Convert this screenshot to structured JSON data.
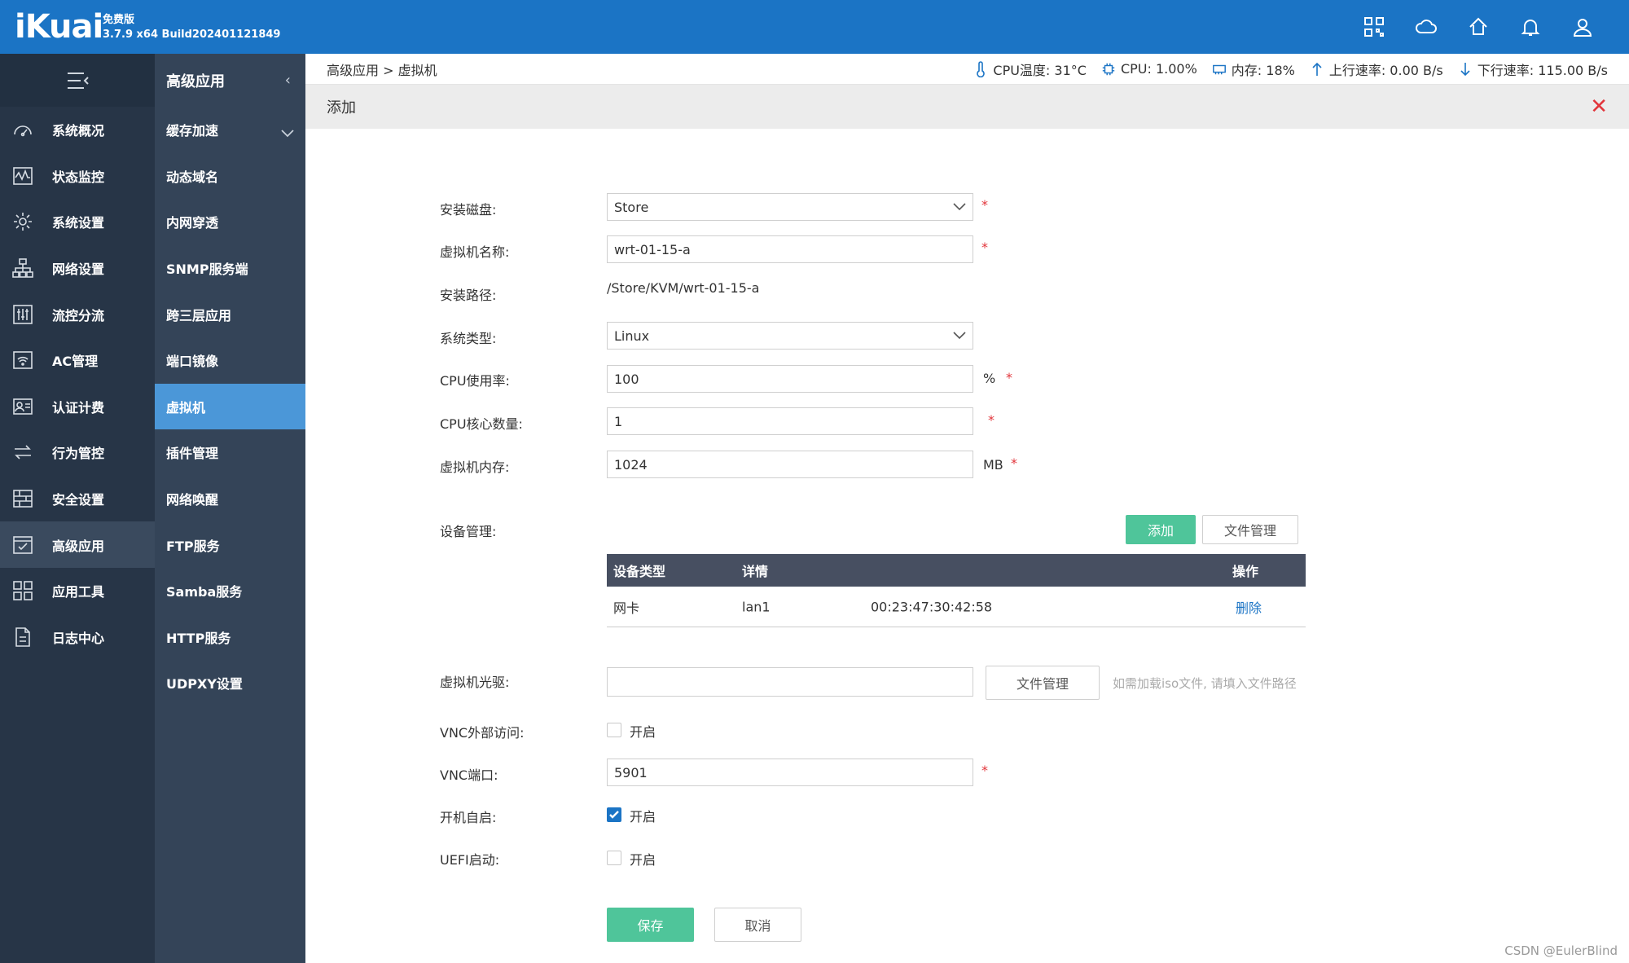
{
  "brand": {
    "logo": "iKuai",
    "edition": "免费版",
    "build": "3.7.9 x64 Build202401121849"
  },
  "top_icons": [
    "qrcode-icon",
    "cloud-icon",
    "home-icon",
    "bell-icon",
    "user-icon"
  ],
  "sidebar": {
    "items": [
      {
        "label": "系统概况",
        "icon": "dashboard-icon"
      },
      {
        "label": "状态监控",
        "icon": "monitor-icon"
      },
      {
        "label": "系统设置",
        "icon": "gear-icon"
      },
      {
        "label": "网络设置",
        "icon": "network-icon"
      },
      {
        "label": "流控分流",
        "icon": "sliders-icon"
      },
      {
        "label": "AC管理",
        "icon": "wifi-icon"
      },
      {
        "label": "认证计费",
        "icon": "id-card-icon"
      },
      {
        "label": "行为管控",
        "icon": "arrows-icon"
      },
      {
        "label": "安全设置",
        "icon": "firewall-icon"
      },
      {
        "label": "高级应用",
        "icon": "check-board-icon"
      },
      {
        "label": "应用工具",
        "icon": "apps-icon"
      },
      {
        "label": "日志中心",
        "icon": "log-icon"
      }
    ],
    "active_index": 9
  },
  "submenu": {
    "title": "高级应用",
    "items": [
      "缓存加速",
      "动态域名",
      "内网穿透",
      "SNMP服务端",
      "跨三层应用",
      "端口镜像",
      "虚拟机",
      "插件管理",
      "网络唤醒",
      "FTP服务",
      "Samba服务",
      "HTTP服务",
      "UDPXY设置"
    ],
    "active": "虚拟机"
  },
  "breadcrumb": "高级应用 > 虚拟机",
  "status": {
    "cpu_temp": "CPU温度: 31°C",
    "cpu": "CPU: 1.00%",
    "memory": "内存: 18%",
    "upload": "上行速率: 0.00 B/s",
    "download": "下行速率: 115.00 B/s"
  },
  "panel": {
    "title": "添加"
  },
  "form": {
    "disk_label": "安装磁盘:",
    "disk_value": "Store",
    "name_label": "虚拟机名称:",
    "name_value": "wrt-01-15-a",
    "path_label": "安装路径:",
    "path_value": "/Store/KVM/wrt-01-15-a",
    "os_label": "系统类型:",
    "os_value": "Linux",
    "cpu_label": "CPU使用率:",
    "cpu_value": "100",
    "cpu_unit": "%",
    "cores_label": "CPU核心数量:",
    "cores_value": "1",
    "mem_label": "虚拟机内存:",
    "mem_value": "1024",
    "mem_unit": "MB",
    "devices_label": "设备管理:",
    "add_button": "添加",
    "file_mgmt_button": "文件管理",
    "device_table": {
      "headers": [
        "设备类型",
        "详情",
        "操作"
      ],
      "rows": [
        {
          "type": "网卡",
          "detail": "lan1",
          "mac": "00:23:47:30:42:58",
          "action": "删除"
        }
      ]
    },
    "cdrom_label": "虚拟机光驱:",
    "cdrom_value": "",
    "cdrom_file_button": "文件管理",
    "cdrom_hint": "如需加载iso文件, 请填入文件路径",
    "vnc_ext_label": "VNC外部访问:",
    "vnc_ext_option": "开启",
    "vnc_ext_checked": false,
    "vnc_port_label": "VNC端口:",
    "vnc_port_value": "5901",
    "autostart_label": "开机自启:",
    "autostart_option": "开启",
    "autostart_checked": true,
    "uefi_label": "UEFI启动:",
    "uefi_option": "开启",
    "uefi_checked": false,
    "required_mark": "*",
    "save_button": "保存",
    "cancel_button": "取消"
  },
  "watermark": "CSDN @EulerBlind",
  "colors": {
    "topbar": "#1b74c5",
    "sidebar": "#273547",
    "submenu": "#344458",
    "submenu_active": "#4b97d8",
    "green_button": "#4fc59a",
    "required": "#e2353b",
    "table_header": "#474f61"
  }
}
